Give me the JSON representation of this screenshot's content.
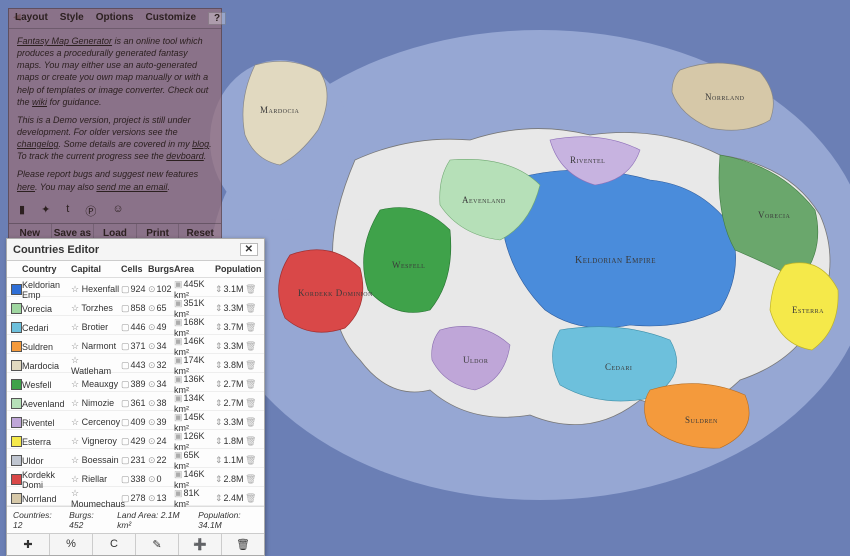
{
  "info": {
    "tabs": [
      "Layout",
      "Style",
      "Options",
      "Customize"
    ],
    "q": "?",
    "p1a": "Fantasy Map Generator",
    "p1b": " is an online tool which produces a procedurally generated fantasy maps. You may either use an auto-generated maps or create you own map manually or with a help of templates or image converter. Check out the ",
    "p1c": "wiki",
    "p1d": " for guidance.",
    "p2a": "This is a Demo version, project is still under development. For older versions see the ",
    "p2b": "changelog",
    "p2c": ". Some details are covered in my ",
    "p2d": "blog",
    "p2e": ". To track the current progress see the ",
    "p2f": "devboard",
    "p2g": ".",
    "p3a": "Please report bugs and suggest new features ",
    "p3b": "here",
    "p3c": ". You may also ",
    "p3d": "send me an email",
    "p3e": ".",
    "buttons": [
      "New Map",
      "Save as",
      "Load",
      "Print",
      "Reset Zoom"
    ]
  },
  "editor": {
    "title": "Countries Editor",
    "headers": [
      "Country",
      "Capital",
      "Cells",
      "Burgs",
      "Area",
      "Population"
    ],
    "rows": [
      {
        "color": "#2f6fd6",
        "name": "Keldorian Emp",
        "capital": "Hexenfall",
        "cells": "924",
        "burgs": "102",
        "area": "445K km²",
        "pop": "3.1M"
      },
      {
        "color": "#9fd6a0",
        "name": "Vorecia",
        "capital": "Torzhes",
        "cells": "858",
        "burgs": "65",
        "area": "351K km²",
        "pop": "3.3M"
      },
      {
        "color": "#6dc0dc",
        "name": "Cedari",
        "capital": "Brotier",
        "cells": "446",
        "burgs": "49",
        "area": "168K km²",
        "pop": "3.7M"
      },
      {
        "color": "#f49a3c",
        "name": "Suldren",
        "capital": "Narmont",
        "cells": "371",
        "burgs": "34",
        "area": "146K km²",
        "pop": "3.3M"
      },
      {
        "color": "#e1d9c0",
        "name": "Mardocia",
        "capital": "Watleham",
        "cells": "443",
        "burgs": "32",
        "area": "174K km²",
        "pop": "3.8M"
      },
      {
        "color": "#3fa24a",
        "name": "Wesfell",
        "capital": "Meauxgy",
        "cells": "389",
        "burgs": "34",
        "area": "136K km²",
        "pop": "2.7M"
      },
      {
        "color": "#b6e0b8",
        "name": "Aevenland",
        "capital": "Nimozie",
        "cells": "361",
        "burgs": "38",
        "area": "134K km²",
        "pop": "2.7M"
      },
      {
        "color": "#bfa6d8",
        "name": "Riventel",
        "capital": "Cercenoy",
        "cells": "409",
        "burgs": "39",
        "area": "145K km²",
        "pop": "3.3M"
      },
      {
        "color": "#f5e94a",
        "name": "Esterra",
        "capital": "Vigneroy",
        "cells": "429",
        "burgs": "24",
        "area": "126K km²",
        "pop": "1.8M"
      },
      {
        "color": "#bfc5d0",
        "name": "Uldor",
        "capital": "Boessain",
        "cells": "231",
        "burgs": "22",
        "area": "65K km²",
        "pop": "1.1M"
      },
      {
        "color": "#d94848",
        "name": "Kordekk Domi",
        "capital": "Riellar",
        "cells": "338",
        "burgs": "0",
        "area": "146K km²",
        "pop": "2.8M"
      },
      {
        "color": "#d6c8a8",
        "name": "Norrland",
        "capital": "Moumechaus",
        "cells": "278",
        "burgs": "13",
        "area": "81K km²",
        "pop": "2.4M"
      }
    ],
    "summary": {
      "countries": "Countries: 12",
      "burgs": "Burgs: 452",
      "area": "Land Area: 2.1M km²",
      "pop": "Population: 34.1M"
    },
    "tools": [
      "✚",
      "%",
      "C",
      "✎",
      "➕",
      "🗑"
    ]
  },
  "labels": {
    "mardocia": "Mardocia",
    "norrland": "Norrland",
    "riventel": "Riventel",
    "vorecia": "Vorecia",
    "aevenland": "Aevenland",
    "keldorian": "Keldorian Empire",
    "wesfell": "Wesfell",
    "kordekk": "Kordekk Dominion",
    "uldor": "Uldor",
    "cedari": "Cedari",
    "suldren": "Suldren",
    "esterra": "Esterra"
  }
}
